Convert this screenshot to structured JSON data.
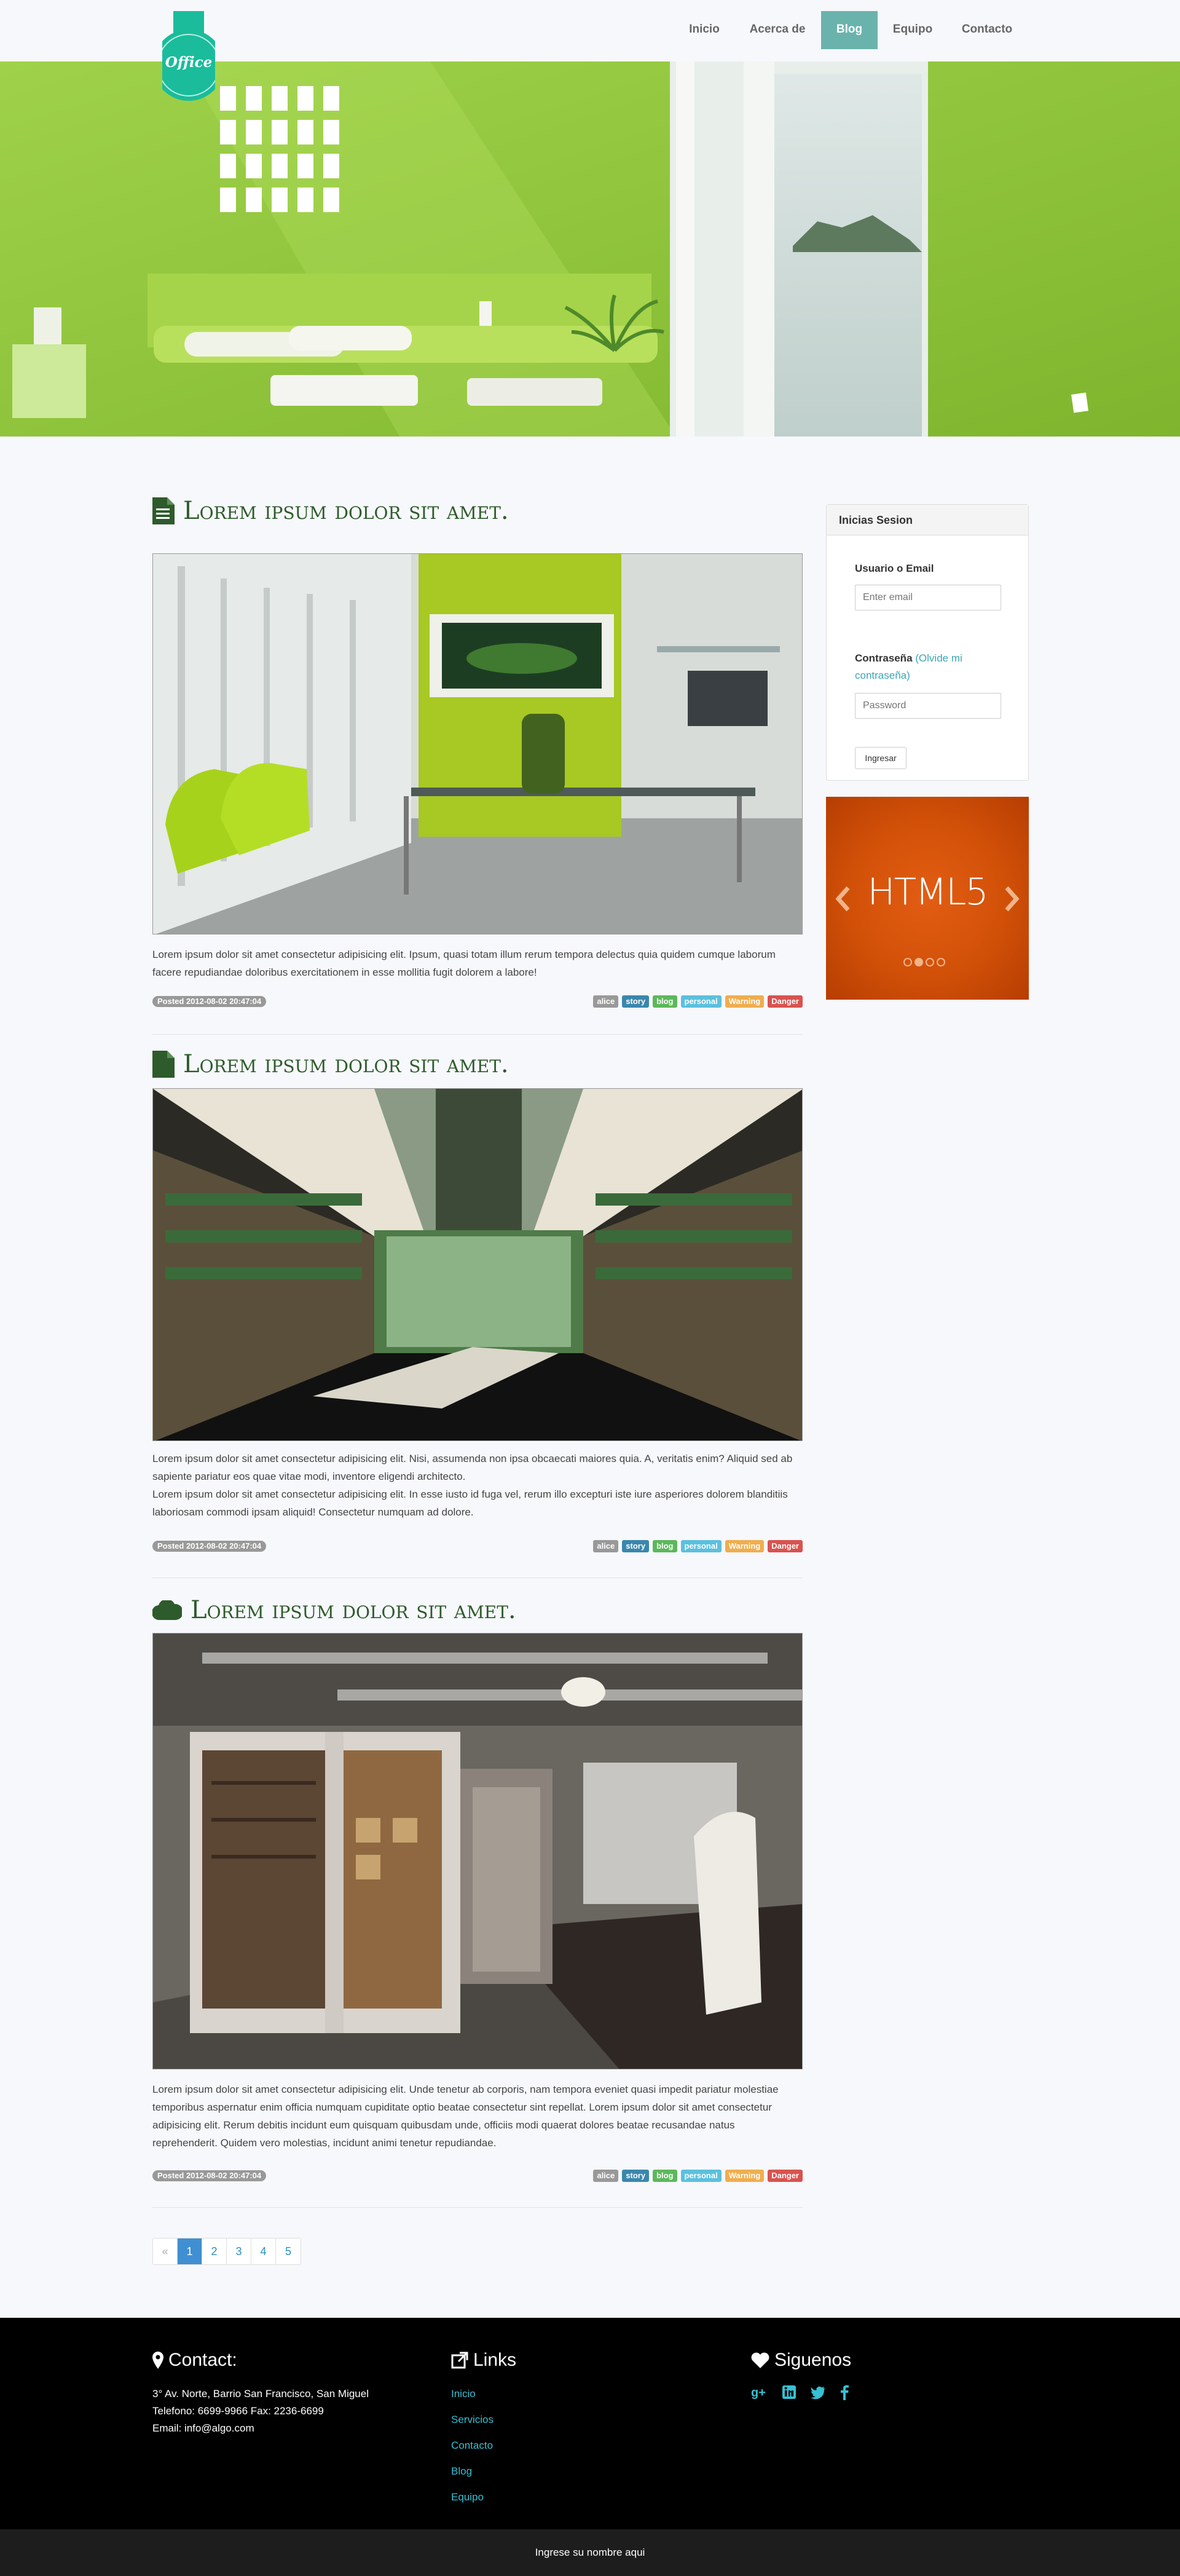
{
  "brand": {
    "logo_text": "Office"
  },
  "nav": {
    "items": [
      {
        "label": "Inicio"
      },
      {
        "label": "Acerca de"
      },
      {
        "label": "Blog",
        "active": true
      },
      {
        "label": "Equipo"
      },
      {
        "label": "Contacto"
      }
    ]
  },
  "posts": [
    {
      "title": "Lorem ipsum dolor sit amet.",
      "icon": "document-icon",
      "text": "Lorem ipsum dolor sit amet consectetur adipisicing elit. Ipsum, quasi totam illum rerum tempora delectus quia quidem cumque laborum facere repudiandae doloribus exercitationem in esse mollitia fugit dolorem a labore!",
      "posted": "Posted 2012-08-02 20:47:04"
    },
    {
      "title": "Lorem ipsum dolor sit amet.",
      "icon": "file-icon",
      "text": "Lorem ipsum dolor sit amet consectetur adipisicing elit. Nisi, assumenda non ipsa obcaecati maiores quia. A, veritatis enim? Aliquid sed ab sapiente pariatur eos quae vitae modi, inventore eligendi architecto.",
      "text2": "Lorem ipsum dolor sit amet consectetur adipisicing elit. In esse iusto id fuga vel, rerum illo excepturi iste iure asperiores dolorem blanditiis laboriosam commodi ipsam aliquid! Consectetur numquam ad dolore.",
      "posted": "Posted 2012-08-02 20:47:04"
    },
    {
      "title": "Lorem ipsum dolor sit amet.",
      "icon": "cloud-icon",
      "text": "Lorem ipsum dolor sit amet consectetur adipisicing elit. Unde tenetur ab corporis, nam tempora eveniet quasi impedit pariatur molestiae temporibus aspernatur enim officia numquam cupiditate optio beatae consectetur sint repellat. Lorem ipsum dolor sit amet consectetur adipisicing elit. Rerum debitis incidunt eum quisquam quibusdam unde, officiis modi quaerat dolores beatae recusandae natus reprehenderit. Quidem vero molestias, incidunt animi tenetur repudiandae.",
      "posted": "Posted 2012-08-02 20:47:04"
    }
  ],
  "tags": [
    {
      "label": "alice",
      "color": "#999999"
    },
    {
      "label": "story",
      "color": "#3a87ad"
    },
    {
      "label": "blog",
      "color": "#5cb85c"
    },
    {
      "label": "personal",
      "color": "#5bc0de"
    },
    {
      "label": "Warning",
      "color": "#f0ad4e"
    },
    {
      "label": "Danger",
      "color": "#d9534f"
    }
  ],
  "login": {
    "heading": "Inicias Sesion",
    "user_label": "Usuario o Email",
    "email_placeholder": "Enter email",
    "password_label": "Contraseña",
    "forgot_label": "(Olvide mi contraseña)",
    "password_placeholder": "Password",
    "submit_label": "Ingresar"
  },
  "carousel": {
    "text": "HTML5",
    "slides": 4,
    "active_slide": 2
  },
  "pagination": {
    "prev": "«",
    "pages": [
      "1",
      "2",
      "3",
      "4",
      "5"
    ],
    "active": "1"
  },
  "footer": {
    "contact": {
      "title": "Contact:",
      "address": "3° Av. Norte, Barrio San Francisco, San Miguel",
      "phone": "Telefono: 6699-9966 Fax: 2236-6699",
      "email": "Email: info@algo.com"
    },
    "links": {
      "title": "Links",
      "items": [
        "Inicio",
        "Servicios",
        "Contacto",
        "Blog",
        "Equipo"
      ]
    },
    "social": {
      "title": "Siguenos",
      "icons": [
        "google-plus-icon",
        "linkedin-icon",
        "twitter-icon",
        "facebook-icon"
      ]
    },
    "bottom_text": "Ingrese su nombre aqui"
  },
  "colors": {
    "accent": "#6ab3ad",
    "title_green": "#2e5b2b",
    "link_cyan": "#35c0d4",
    "hero_green": "#8fc43d"
  }
}
